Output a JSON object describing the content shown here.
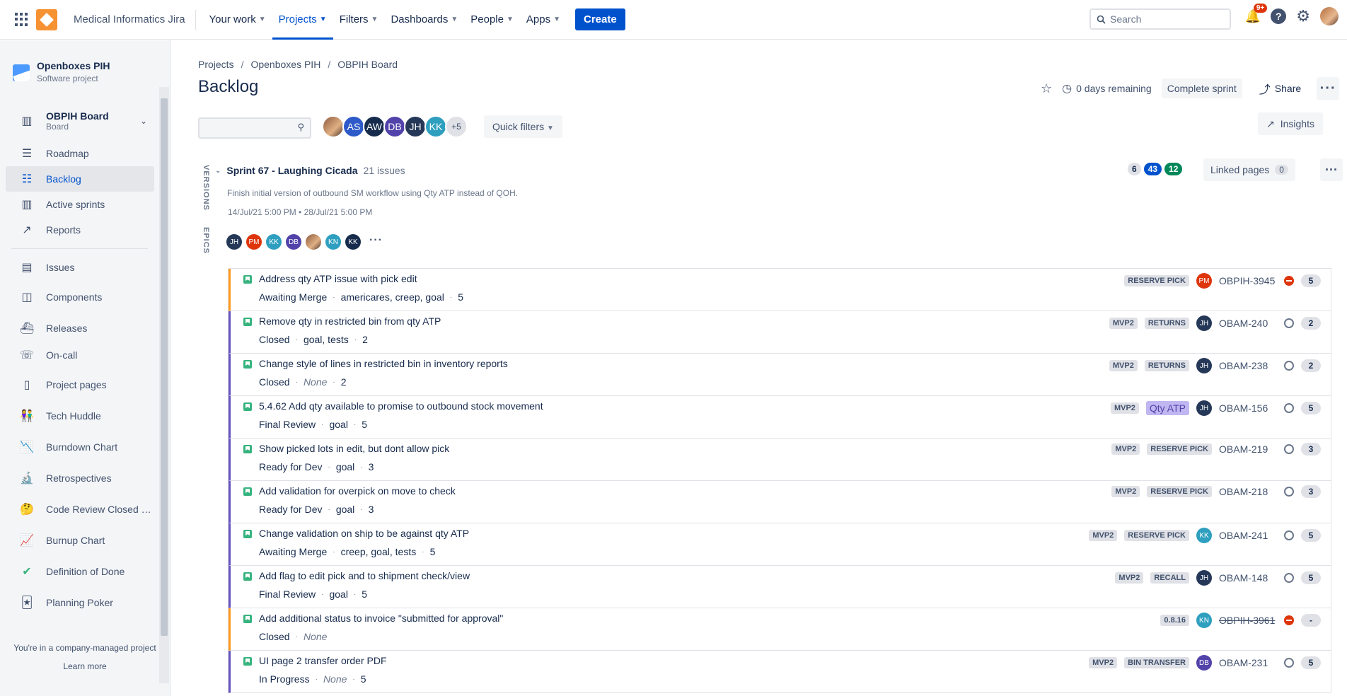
{
  "topbar": {
    "site": "Medical Informatics Jira",
    "nav": [
      {
        "label": "Your work"
      },
      {
        "label": "Projects"
      },
      {
        "label": "Filters"
      },
      {
        "label": "Dashboards"
      },
      {
        "label": "People"
      },
      {
        "label": "Apps"
      }
    ],
    "create": "Create",
    "search_placeholder": "Search",
    "notif_badge": "9+",
    "help": "?"
  },
  "sidebar": {
    "project_name": "Openboxes PIH",
    "project_type": "Software project",
    "board_name": "OBPIH Board",
    "board_type": "Board",
    "items": [
      {
        "label": "Roadmap",
        "icon": "roadmap-icon"
      },
      {
        "label": "Backlog",
        "icon": "backlog-icon"
      },
      {
        "label": "Active sprints",
        "icon": "columns-icon"
      },
      {
        "label": "Reports",
        "icon": "chart-icon"
      },
      {
        "label": "Issues",
        "icon": "issues-icon"
      },
      {
        "label": "Components",
        "icon": "components-icon"
      },
      {
        "label": "Releases",
        "icon": "ship-icon"
      },
      {
        "label": "On-call",
        "icon": "phone-icon"
      },
      {
        "label": "Project pages",
        "icon": "page-icon"
      },
      {
        "label": "Tech Huddle",
        "icon": "people-emoji-icon"
      },
      {
        "label": "Burndown Chart",
        "icon": "chart-down-emoji-icon"
      },
      {
        "label": "Retrospectives",
        "icon": "microscope-emoji-icon"
      },
      {
        "label": "Code Review Closed …",
        "icon": "thinking-emoji-icon"
      },
      {
        "label": "Burnup Chart",
        "icon": "chart-up-emoji-icon"
      },
      {
        "label": "Definition of Done",
        "icon": "check-emoji-icon"
      },
      {
        "label": "Planning Poker",
        "icon": "joker-emoji-icon"
      }
    ],
    "footer": "You're in a company-managed project",
    "learn_more": "Learn more"
  },
  "breadcrumb": [
    "Projects",
    "Openboxes PIH",
    "OBPIH Board"
  ],
  "page_title": "Backlog",
  "header_actions": {
    "days_remaining": "0 days remaining",
    "complete_sprint": "Complete sprint",
    "share": "Share"
  },
  "filters": {
    "avatars": [
      "AS",
      "AW",
      "DB",
      "JH",
      "KK"
    ],
    "more": "+5",
    "quick_filters": "Quick filters",
    "insights": "Insights"
  },
  "side_tabs": {
    "versions": "VERSIONS",
    "epics": "EPICS"
  },
  "sprint": {
    "name": "Sprint 67 - Laughing Cicada",
    "count": "21 issues",
    "goal": "Finish initial version of outbound SM workflow using Qty ATP instead of QOH.",
    "dates": "14/Jul/21 5:00 PM • 28/Jul/21 5:00 PM",
    "assignees": [
      "JH",
      "PM",
      "KK",
      "DB",
      "",
      "KN",
      "KK"
    ],
    "counts": {
      "todo": "6",
      "in_progress": "43",
      "done": "12"
    },
    "linked_pages": "Linked pages",
    "linked_count": "0"
  },
  "issues": [
    {
      "summary": "Address qty ATP issue with pick edit",
      "status": "Awaiting Merge",
      "labels": "americares, creep, goal",
      "points": "5",
      "tags": [
        "RESERVE PICK"
      ],
      "assignee": "PM",
      "key": "OBPIH-3945",
      "priority": "blocker",
      "estimate": "5",
      "epic": "orange"
    },
    {
      "summary": "Remove qty in restricted bin from qty ATP",
      "status": "Closed",
      "labels": "goal, tests",
      "points": "2",
      "tags": [
        "MVP2",
        "RETURNS"
      ],
      "assignee": "JH",
      "key": "OBAM-240",
      "priority": "normal",
      "estimate": "2",
      "epic": "purple"
    },
    {
      "summary": "Change style of lines in restricted bin in inventory reports",
      "status": "Closed",
      "labels": "None",
      "points": "2",
      "tags": [
        "MVP2",
        "RETURNS"
      ],
      "assignee": "JH",
      "key": "OBAM-238",
      "priority": "normal",
      "estimate": "2",
      "epic": "purple"
    },
    {
      "summary": "5.4.62 Add qty available to promise to outbound stock movement",
      "status": "Final Review",
      "labels": "goal",
      "points": "5",
      "tags": [
        "MVP2",
        "Qty ATP"
      ],
      "assignee": "JH",
      "key": "OBAM-156",
      "priority": "normal",
      "estimate": "5",
      "epic": "purple"
    },
    {
      "summary": "Show picked lots in edit, but dont allow pick",
      "status": "Ready for Dev",
      "labels": "goal",
      "points": "3",
      "tags": [
        "MVP2",
        "RESERVE PICK"
      ],
      "assignee": "",
      "key": "OBAM-219",
      "priority": "normal",
      "estimate": "3",
      "epic": "purple"
    },
    {
      "summary": "Add validation for overpick on move to check",
      "status": "Ready for Dev",
      "labels": "goal",
      "points": "3",
      "tags": [
        "MVP2",
        "RESERVE PICK"
      ],
      "assignee": "",
      "key": "OBAM-218",
      "priority": "normal",
      "estimate": "3",
      "epic": "purple"
    },
    {
      "summary": "Change validation on ship to be against qty ATP",
      "status": "Awaiting Merge",
      "labels": "creep, goal, tests",
      "points": "5",
      "tags": [
        "MVP2",
        "RESERVE PICK"
      ],
      "assignee": "KK",
      "key": "OBAM-241",
      "priority": "normal",
      "estimate": "5",
      "epic": "purple"
    },
    {
      "summary": "Add flag to edit pick and to shipment check/view",
      "status": "Final Review",
      "labels": "goal",
      "points": "5",
      "tags": [
        "MVP2",
        "RECALL"
      ],
      "assignee": "JH",
      "key": "OBAM-148",
      "priority": "normal",
      "estimate": "5",
      "epic": "purple"
    },
    {
      "summary": "Add additional status to invoice \"submitted for approval\"",
      "status": "Closed",
      "labels": "None",
      "points": "",
      "tags": [
        "0.8.16"
      ],
      "assignee": "KN",
      "key": "OBPIH-3961",
      "priority": "blocker",
      "estimate": "-",
      "epic": "orange"
    },
    {
      "summary": "UI page 2 transfer order PDF",
      "status": "In Progress",
      "labels": "None",
      "points": "5",
      "tags": [
        "MVP2",
        "BIN TRANSFER"
      ],
      "assignee": "DB",
      "key": "OBAM-231",
      "priority": "normal",
      "estimate": "5",
      "epic": "purple"
    }
  ],
  "colors": {
    "accent": "#0052cc",
    "JH": "#253858",
    "PM": "#de350b",
    "KK": "#2e9fbf",
    "DB": "#5243aa",
    "KN": "#2e9fbf",
    "AS": "#2d5ac8",
    "AW": "#172b4d"
  }
}
